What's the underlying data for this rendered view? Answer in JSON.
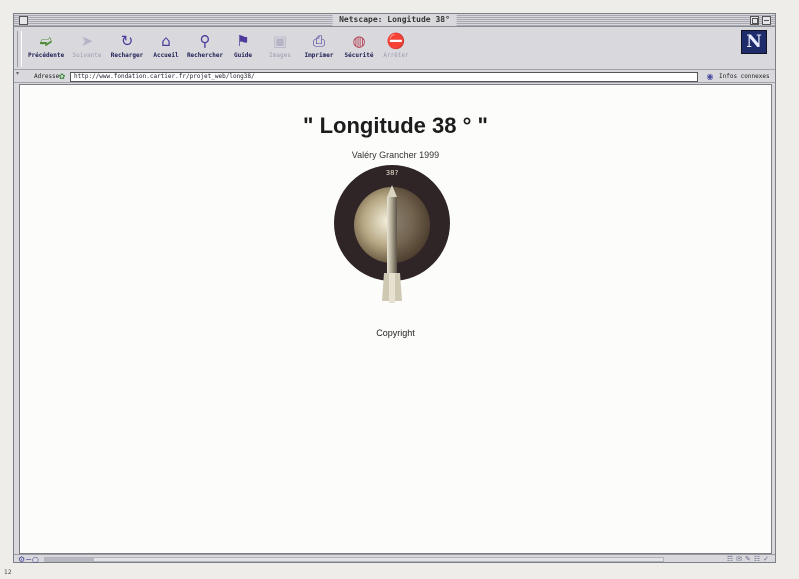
{
  "window": {
    "title": "Netscape: Longitude 38°"
  },
  "toolbar": {
    "buttons": [
      {
        "label": "Précédente",
        "icon": "back-arrow-icon",
        "enabled": true
      },
      {
        "label": "Suivante",
        "icon": "forward-arrow-icon",
        "enabled": false
      },
      {
        "label": "Recharger",
        "icon": "reload-icon",
        "enabled": true
      },
      {
        "label": "Accueil",
        "icon": "home-icon",
        "enabled": true
      },
      {
        "label": "Rechercher",
        "icon": "search-icon",
        "enabled": true
      },
      {
        "label": "Guide",
        "icon": "guide-icon",
        "enabled": true
      },
      {
        "label": "Images",
        "icon": "images-icon",
        "enabled": false
      },
      {
        "label": "Imprimer",
        "icon": "print-icon",
        "enabled": true
      },
      {
        "label": "Sécurité",
        "icon": "security-lock-icon",
        "enabled": true
      },
      {
        "label": "Arrêter",
        "icon": "stop-icon",
        "enabled": false
      }
    ],
    "logo_letter": "N",
    "logo_icon": "netscape-logo-icon"
  },
  "location": {
    "label": "Adresse",
    "url": "http://www.fondation.cartier.fr/projet_web/long38/",
    "related_label": "Infos connexes"
  },
  "page": {
    "title": "\" Longitude 38 ° \"",
    "author": "Valéry Grancher 1999",
    "artwork_badge": "38?",
    "copyright": "Copyright"
  },
  "status": {
    "progress_fraction": 0.08
  },
  "footer": {
    "page_number": "12"
  },
  "colors": {
    "window_chrome": "#d9d8dc",
    "content_background": "#fcfcfb",
    "title_text": "#1c1c1c",
    "toolbar_label": "#1d1d55",
    "logo_background": "#1f2c6c"
  }
}
